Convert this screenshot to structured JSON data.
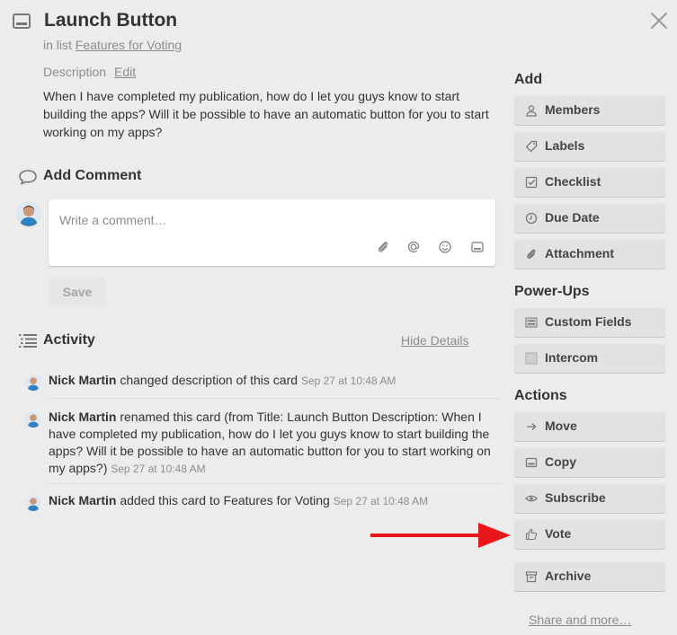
{
  "card": {
    "title": "Launch Button",
    "in_list_prefix": "in list",
    "list_name": "Features for Voting",
    "description_label": "Description",
    "edit_label": "Edit",
    "description": "When I have completed my publication, how do I let you guys know to start building the apps? Will it be possible to have an automatic button for you to start working on my apps?"
  },
  "comment": {
    "heading": "Add Comment",
    "placeholder": "Write a comment…",
    "value": "",
    "save_label": "Save",
    "toolbar_icons": [
      "attachment-icon",
      "mention-icon",
      "emoji-icon",
      "card-icon"
    ]
  },
  "activity": {
    "heading": "Activity",
    "hide_details": "Hide Details",
    "items": [
      {
        "user": "Nick Martin",
        "text": "changed description of this card",
        "time": "Sep 27 at 10:48 AM"
      },
      {
        "user": "Nick Martin",
        "text": "renamed this card (from Title: Launch Button Description: When I have completed my publication, how do I let you guys know to start building the apps? Will it be possible to have an automatic button for you to start working on my apps?)",
        "time": "Sep 27 at 10:48 AM"
      },
      {
        "user": "Nick Martin",
        "text": "added this card to Features for Voting",
        "time": "Sep 27 at 10:48 AM"
      }
    ]
  },
  "sidebar": {
    "add_heading": "Add",
    "add_buttons": [
      {
        "label": "Members",
        "icon": "person-icon"
      },
      {
        "label": "Labels",
        "icon": "tag-icon"
      },
      {
        "label": "Checklist",
        "icon": "checkbox-icon"
      },
      {
        "label": "Due Date",
        "icon": "clock-icon"
      },
      {
        "label": "Attachment",
        "icon": "paperclip-icon"
      }
    ],
    "powerups_heading": "Power-Ups",
    "powerup_buttons": [
      {
        "label": "Custom Fields",
        "icon": "custom-fields-icon"
      },
      {
        "label": "Intercom",
        "icon": "intercom-icon"
      }
    ],
    "actions_heading": "Actions",
    "action_buttons": [
      {
        "label": "Move",
        "icon": "arrow-right-icon"
      },
      {
        "label": "Copy",
        "icon": "card-icon"
      },
      {
        "label": "Subscribe",
        "icon": "eye-icon"
      },
      {
        "label": "Vote",
        "icon": "thumbs-up-icon"
      },
      {
        "label": "Archive",
        "icon": "archive-icon"
      }
    ],
    "share_more": "Share and more…"
  },
  "colors": {
    "background": "#ececec",
    "button": "#e2e2e2",
    "annotation_arrow": "#e8171c"
  }
}
